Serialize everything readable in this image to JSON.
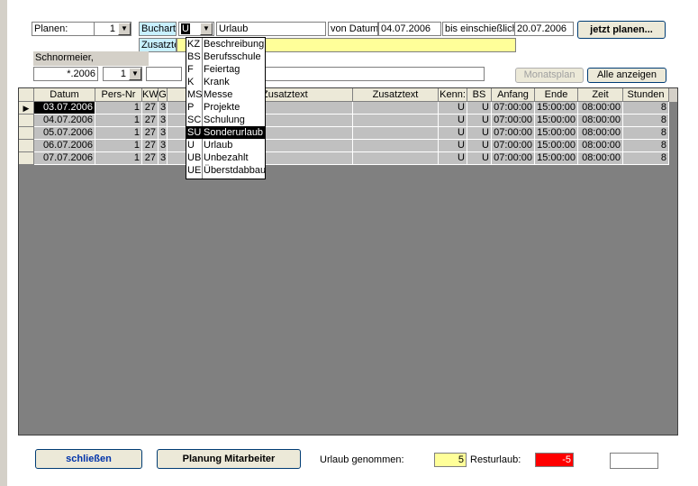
{
  "top": {
    "planen_label": "Planen:",
    "planen_value": "1",
    "buchart_label": "Buchart:",
    "buchart_value": "U",
    "buchart_desc": "Urlaub",
    "von_label": "von Datum:",
    "von_value": "04.07.2006",
    "bis_label": "bis einschießlich:",
    "bis_value": "20.07.2006",
    "plan_button": "jetzt planen...",
    "zusatztext_label": "Zusatztext"
  },
  "second": {
    "employee_name": "Schnormeier,",
    "year_field": "*.2006",
    "month_value": "1",
    "monatsplan_button": "Monatsplan",
    "alle_button": "Alle anzeigen"
  },
  "grid": {
    "columns": [
      "Datum",
      "Pers-Nr",
      "KW",
      "G",
      "Zusatztext",
      "Zusatztext",
      "Kenn:",
      "BS",
      "Anfang",
      "Ende",
      "Zeit",
      "Stunden"
    ],
    "rows": [
      {
        "datum": "03.07.2006",
        "pers": "1",
        "kw": "27",
        "g": "3",
        "kenn": "U",
        "bs": "U",
        "anfang": "07:00:00",
        "ende": "15:00:00",
        "zeit": "08:00:00",
        "stunden": "8"
      },
      {
        "datum": "04.07.2006",
        "pers": "1",
        "kw": "27",
        "g": "3",
        "kenn": "U",
        "bs": "U",
        "anfang": "07:00:00",
        "ende": "15:00:00",
        "zeit": "08:00:00",
        "stunden": "8"
      },
      {
        "datum": "05.07.2006",
        "pers": "1",
        "kw": "27",
        "g": "3",
        "kenn": "U",
        "bs": "U",
        "anfang": "07:00:00",
        "ende": "15:00:00",
        "zeit": "08:00:00",
        "stunden": "8"
      },
      {
        "datum": "06.07.2006",
        "pers": "1",
        "kw": "27",
        "g": "3",
        "kenn": "U",
        "bs": "U",
        "anfang": "07:00:00",
        "ende": "15:00:00",
        "zeit": "08:00:00",
        "stunden": "8"
      },
      {
        "datum": "07.07.2006",
        "pers": "1",
        "kw": "27",
        "g": "3",
        "kenn": "U",
        "bs": "U",
        "anfang": "07:00:00",
        "ende": "15:00:00",
        "zeit": "08:00:00",
        "stunden": "8"
      }
    ]
  },
  "dropdown": {
    "header": {
      "code": "KZ",
      "desc": "Beschreibung"
    },
    "items": [
      {
        "code": "BS",
        "desc": "Berufsschule"
      },
      {
        "code": "F",
        "desc": "Feiertag"
      },
      {
        "code": "K",
        "desc": "Krank"
      },
      {
        "code": "MS",
        "desc": "Messe"
      },
      {
        "code": "P",
        "desc": "Projekte"
      },
      {
        "code": "SC",
        "desc": "Schulung"
      },
      {
        "code": "SU",
        "desc": "Sonderurlaub"
      },
      {
        "code": "U",
        "desc": "Urlaub"
      },
      {
        "code": "UB",
        "desc": "Unbezahlt"
      },
      {
        "code": "UE",
        "desc": "Überstdabbau"
      }
    ],
    "selected_code": "SU"
  },
  "bottom": {
    "close_button": "schließen",
    "planung_button": "Planung Mitarbeiter",
    "urlaub_label": "Urlaub genommen:",
    "urlaub_value": "5",
    "rest_label": "Resturlaub:",
    "rest_value": "-5"
  },
  "colors": {
    "highlight_yellow": "#ffff99",
    "rest_red": "#ff0000",
    "buchart_bg": "#c8f0ff"
  }
}
